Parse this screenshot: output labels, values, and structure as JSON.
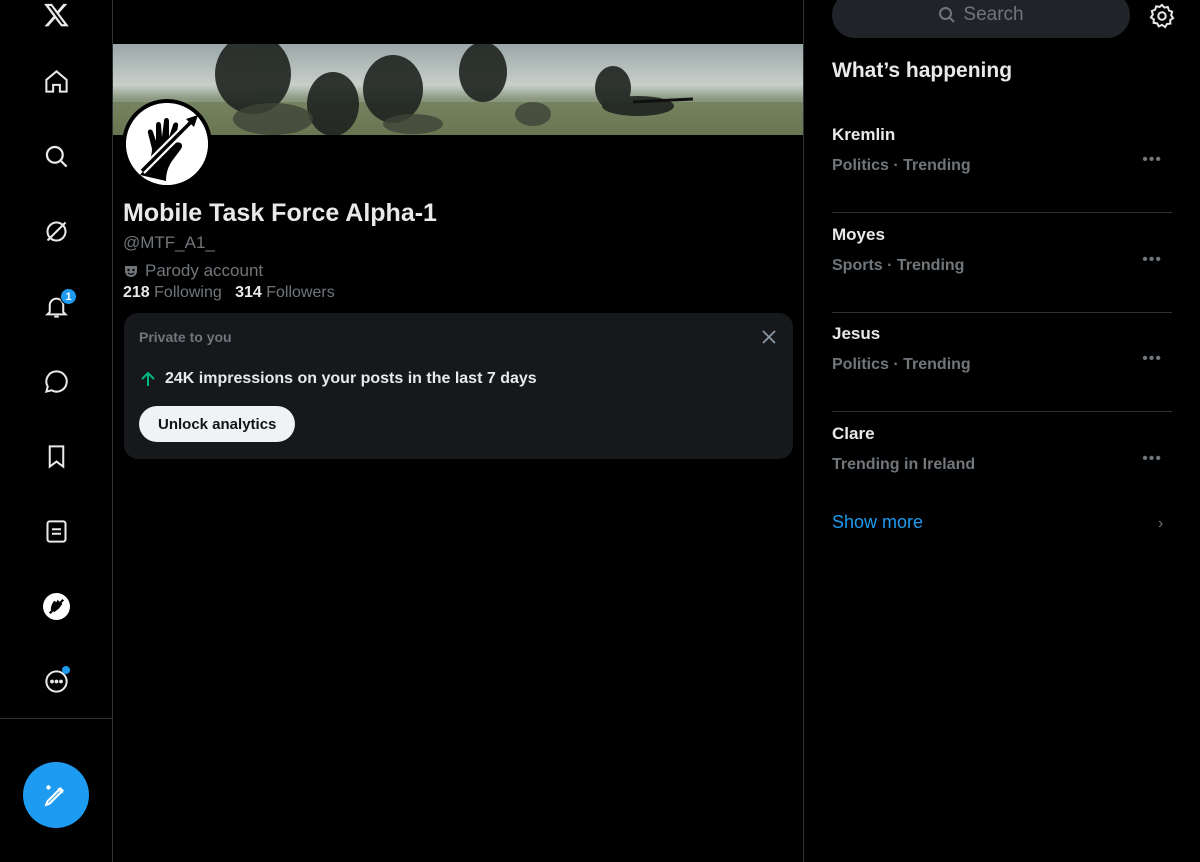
{
  "nav": {
    "notifications_badge": "1"
  },
  "profile": {
    "display_name": "Mobile Task Force Alpha-1",
    "handle": "@MTF_A1_",
    "parody_label": "Parody account",
    "following_count": "218",
    "following_label": "Following",
    "followers_count": "314",
    "followers_label": "Followers"
  },
  "private_card": {
    "label": "Private to you",
    "impressions_text": "24K impressions on your posts in the last 7 days",
    "unlock_label": "Unlock analytics"
  },
  "search": {
    "placeholder": "Search"
  },
  "happening": {
    "title": "What’s happening",
    "trends": [
      {
        "name": "Kremlin",
        "meta": "Politics · Trending"
      },
      {
        "name": "Moyes",
        "meta": "Sports · Trending"
      },
      {
        "name": "Jesus",
        "meta": "Politics · Trending"
      },
      {
        "name": "Clare",
        "meta": "Trending in Ireland"
      }
    ],
    "show_more": "Show more"
  },
  "colors": {
    "accent": "#1d9bf0",
    "background": "#000000",
    "card": "#16181c",
    "muted_text": "#71767b",
    "up_arrow": "#00ba7c"
  }
}
